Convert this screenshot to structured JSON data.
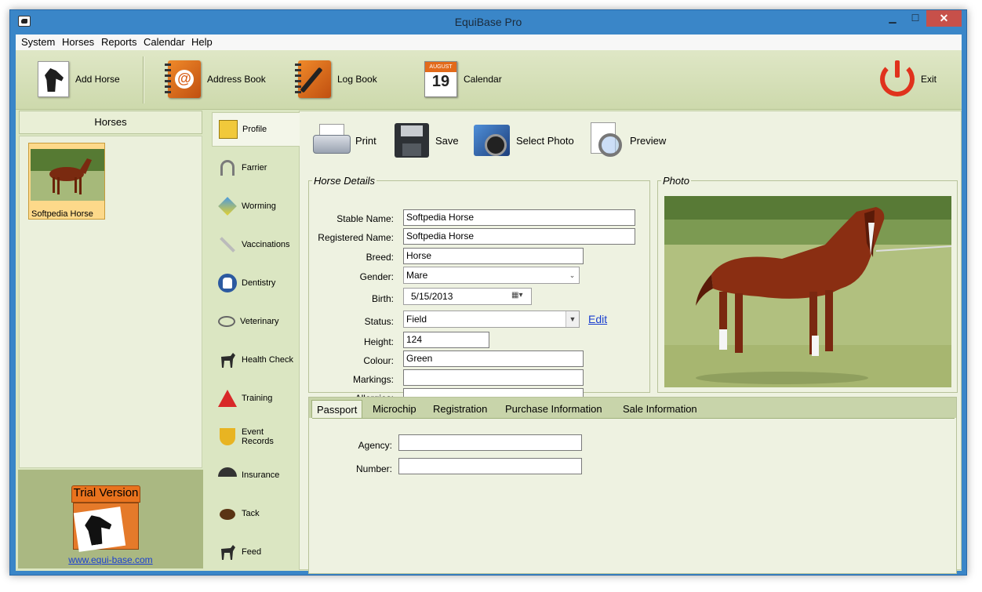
{
  "window": {
    "title": "EquiBase Pro",
    "min": "▁",
    "max": "☐",
    "close": "✕"
  },
  "menu": [
    "System",
    "Horses",
    "Reports",
    "Calendar",
    "Help"
  ],
  "toolbar": {
    "add_horse": "Add Horse",
    "address_book": "Address Book",
    "log_book": "Log Book",
    "calendar": "Calendar",
    "calendar_month": "AUGUST",
    "calendar_day": "19",
    "exit": "Exit"
  },
  "left": {
    "header": "Horses",
    "horses": [
      {
        "name": "Softpedia Horse"
      }
    ],
    "trial": "Trial Version",
    "link": "www.equi-base.com"
  },
  "nav": [
    "Profile",
    "Farrier",
    "Worming",
    "Vaccinations",
    "Dentistry",
    "Veterinary",
    "Health Check",
    "Training",
    "Event Records",
    "Insurance",
    "Tack",
    "Feed"
  ],
  "actions": {
    "print": "Print",
    "save": "Save",
    "select_photo": "Select Photo",
    "preview": "Preview"
  },
  "details": {
    "legend": "Horse Details",
    "stable_name_label": "Stable Name:",
    "stable_name": "Softpedia Horse",
    "registered_name_label": "Registered Name:",
    "registered_name": "Softpedia Horse",
    "breed_label": "Breed:",
    "breed": "Horse",
    "gender_label": "Gender:",
    "gender": "Mare",
    "birth_label": "Birth:",
    "birth": "5/15/2013",
    "status_label": "Status:",
    "status": "Field",
    "edit": "Edit",
    "height_label": "Height:",
    "height": "124",
    "colour_label": "Colour:",
    "colour": "Green",
    "markings_label": "Markings:",
    "markings": "",
    "allergies_label": "Allergies:",
    "allergies": ""
  },
  "photo": {
    "legend": "Photo"
  },
  "tabs": {
    "items": [
      "Passport",
      "Microchip",
      "Registration",
      "Purchase Information",
      "Sale Information"
    ],
    "active": "Passport",
    "agency_label": "Agency:",
    "agency": "",
    "number_label": "Number:",
    "number": ""
  },
  "colors": {
    "accent": "#3a86c8",
    "panel": "#dbe6c2",
    "link": "#1a3fd0",
    "close": "#c7504a"
  }
}
